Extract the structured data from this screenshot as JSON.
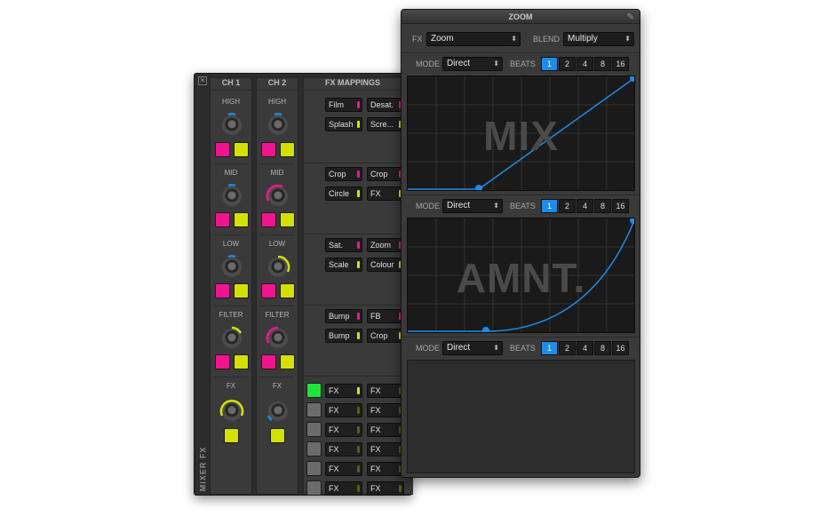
{
  "mixer": {
    "title": "MIXER FX",
    "ch1": {
      "label": "CH 1"
    },
    "ch2": {
      "label": "CH 2"
    },
    "sections": {
      "high": "HIGH",
      "mid": "MID",
      "low": "LOW",
      "filter": "FILTER",
      "fx": "FX"
    },
    "fx_mappings": {
      "title": "FX MAPPINGS",
      "groups": [
        [
          [
            "Film",
            "Desat."
          ],
          [
            "Splash",
            "Scre..."
          ]
        ],
        [
          [
            "Crop",
            "Crop"
          ],
          [
            "Circle",
            "FX"
          ]
        ],
        [
          [
            "Sat.",
            "Zoom"
          ],
          [
            "Scale",
            "Colour"
          ]
        ],
        [
          [
            "Bump",
            "FB"
          ],
          [
            "Bump",
            "Crop"
          ]
        ]
      ],
      "bottom_rows": [
        "FX",
        "FX",
        "FX",
        "FX",
        "FX",
        "FX"
      ]
    }
  },
  "zoom": {
    "title": "ZOOM",
    "fx_label": "FX",
    "fx_value": "Zoom",
    "blend_label": "BLEND",
    "blend_value": "Multiply",
    "mode_label": "MODE",
    "mode_value": "Direct",
    "beats_label": "BEATS",
    "beat_options": [
      "1",
      "2",
      "4",
      "8",
      "16"
    ],
    "selected_beat": "1",
    "graph1_word": "MIX",
    "graph2_word": "AMNT."
  },
  "colors": {
    "accent": "#1e8be6",
    "magenta": "#f0158f",
    "yellow": "#d4e000",
    "green": "#1ee53b"
  }
}
